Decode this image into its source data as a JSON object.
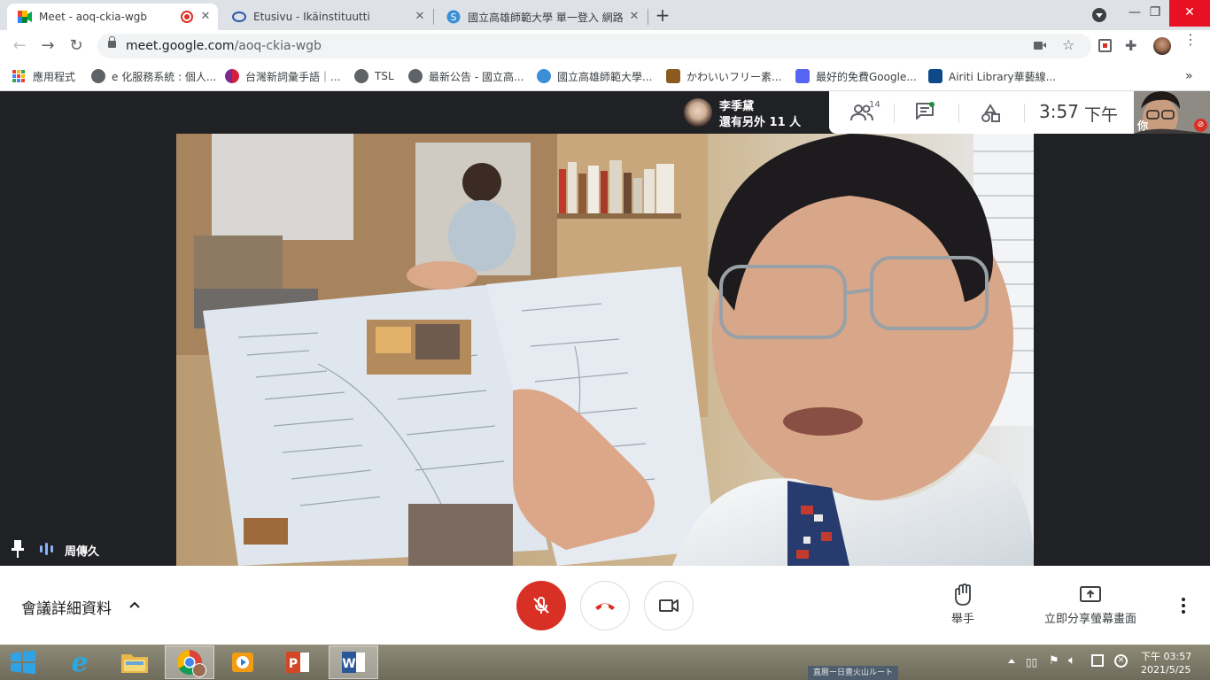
{
  "browser": {
    "tabs": [
      {
        "title": "Meet - aoq-ckia-wgb",
        "active": true,
        "recording_dot": true
      },
      {
        "title": "Etusivu - Ikäinstituutti",
        "active": false
      },
      {
        "title": "國立高雄師範大學 單一登入 網路",
        "active": false
      }
    ],
    "url_host": "meet.google.com",
    "url_path": "/aoq-ckia-wgb",
    "bookmarks": [
      {
        "label": "應用程式",
        "icon": "apps-grid-icon"
      },
      {
        "label": "e 化服務系統 : 個人...",
        "icon": "globe-icon"
      },
      {
        "label": "台灣新詞彙手語｜...",
        "icon": "sign-language-icon"
      },
      {
        "label": "TSL",
        "icon": "globe-icon"
      },
      {
        "label": "最新公告 - 國立高...",
        "icon": "globe-icon"
      },
      {
        "label": "國立高雄師範大學...",
        "icon": "nknu-icon"
      },
      {
        "label": "かわいいフリー素...",
        "icon": "irasutoya-icon"
      },
      {
        "label": "最好的免費Google...",
        "icon": "discord-icon"
      },
      {
        "label": "Airiti Library華藝線...",
        "icon": "airiti-icon"
      }
    ],
    "more_bookmarks": "»"
  },
  "meet": {
    "presenter_name": "李季黛",
    "presenter_sub": "還有另外 11 人",
    "participant_count": "14",
    "time": "3:57",
    "time_suffix": "下午",
    "self_label": "你",
    "speaker_name": "周傳久",
    "meeting_details_label": "會議詳細資料",
    "raise_hand_label": "舉手",
    "present_now_label": "立即分享螢幕畫面"
  },
  "taskbar": {
    "clock_time": "下午 03:57",
    "clock_date": "2021/5/25",
    "wallpaper_sign": "直暦ー日豊火山ルート"
  },
  "colors": {
    "meet_red": "#d93025",
    "chrome_tab_bg": "#dee1e6",
    "meet_dark": "#202124",
    "accent_blue": "#1a73e8"
  }
}
